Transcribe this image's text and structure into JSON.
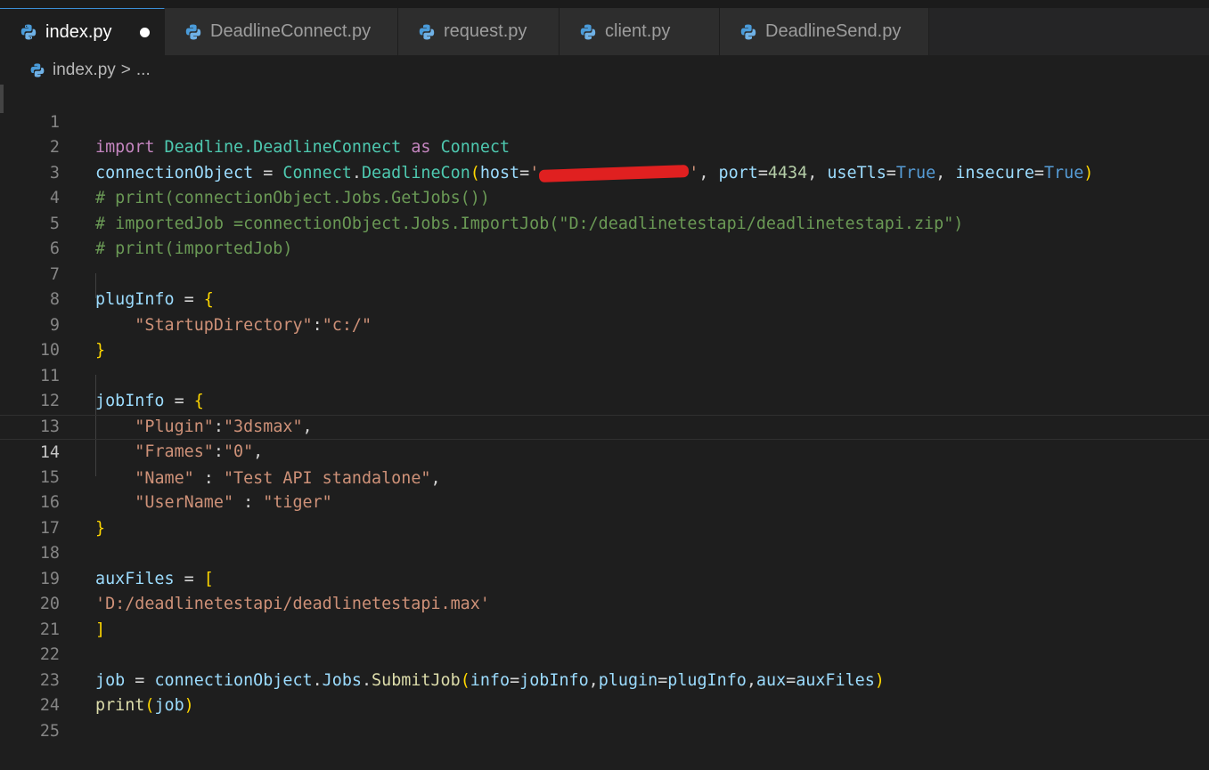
{
  "tabs": [
    {
      "label": "index.py",
      "active": true,
      "modified": true
    },
    {
      "label": "DeadlineConnect.py"
    },
    {
      "label": "request.py"
    },
    {
      "label": "client.py"
    },
    {
      "label": "DeadlineSend.py"
    }
  ],
  "breadcrumb": {
    "file": "index.py",
    "separator": ">",
    "more": "..."
  },
  "line_numbers": [
    "1",
    "2",
    "3",
    "4",
    "5",
    "6",
    "7",
    "8",
    "9",
    "10",
    "11",
    "12",
    "13",
    "14",
    "15",
    "16",
    "17",
    "18",
    "19",
    "20",
    "21",
    "22",
    "23",
    "24",
    "25"
  ],
  "current_line": "14",
  "code": {
    "l1": {
      "import": "import",
      "module": "Deadline.DeadlineConnect",
      "as": "as",
      "alias": "Connect"
    },
    "l2": {
      "var": "connectionObject",
      "eq": " = ",
      "mod": "Connect",
      "dot": ".",
      "fn": "DeadlineCon",
      "open": "(",
      "host": "host",
      "eq2": "=",
      "q1": "'",
      "q2": "'",
      "comma1": ", ",
      "port": "port",
      "eq3": "=",
      "portval": "4434",
      "comma2": ", ",
      "tls": "useTls",
      "eq4": "=",
      "tlsval": "True",
      "comma3": ", ",
      "insec": "insecure",
      "eq5": "=",
      "insecval": "True",
      "close": ")"
    },
    "l3": "# print(connectionObject.Jobs.GetJobs())",
    "l4": "# importedJob =connectionObject.Jobs.ImportJob(\"D:/deadlinetestapi/deadlinetestapi.zip\")",
    "l5": "# print(importedJob)",
    "l7": {
      "var": "plugInfo",
      "eq": " = ",
      "brace": "{"
    },
    "l8": {
      "key": "\"StartupDirectory\"",
      "colon": ":",
      "val": "\"c:/\""
    },
    "l9": "}",
    "l11": {
      "var": "jobInfo",
      "eq": " = ",
      "brace": "{"
    },
    "l12": {
      "key": "\"Plugin\"",
      "colon": ":",
      "val": "\"3dsmax\"",
      "comma": ","
    },
    "l13": {
      "key": "\"Frames\"",
      "colon": ":",
      "val": "\"0\"",
      "comma": ","
    },
    "l14": {
      "key": "\"Name\"",
      "colon": " : ",
      "val": "\"Test API standalone\"",
      "comma": ","
    },
    "l15": {
      "key": "\"UserName\"",
      "colon": " : ",
      "val": "\"tiger\""
    },
    "l16": "}",
    "l18": {
      "var": "auxFiles",
      "eq": " = ",
      "bracket": "["
    },
    "l19": "'D:/deadlinetestapi/deadlinetestapi.max'",
    "l20": "]",
    "l22": {
      "var": "job",
      "eq": " = ",
      "obj": "connectionObject",
      "dot1": ".",
      "jobs": "Jobs",
      "dot2": ".",
      "fn": "SubmitJob",
      "open": "(",
      "a1": "info",
      "e1": "=",
      "v1": "jobInfo",
      "c1": ",",
      "a2": "plugin",
      "e2": "=",
      "v2": "plugInfo",
      "c2": ",",
      "a3": "aux",
      "e3": "=",
      "v3": "auxFiles",
      "close": ")"
    },
    "l23": {
      "fn": "print",
      "open": "(",
      "arg": "job",
      "close": ")"
    }
  },
  "colors": {
    "keyword": "#c586c0",
    "class": "#4ec9b0",
    "function": "#dcdcaa",
    "variable": "#9cdcfe",
    "string": "#ce9178",
    "number": "#b5cea8",
    "boolean": "#569cd6",
    "comment": "#6a9955",
    "redaction": "#e02020"
  },
  "icons": {
    "python_file": "python-icon",
    "modified_indicator": "dot"
  }
}
